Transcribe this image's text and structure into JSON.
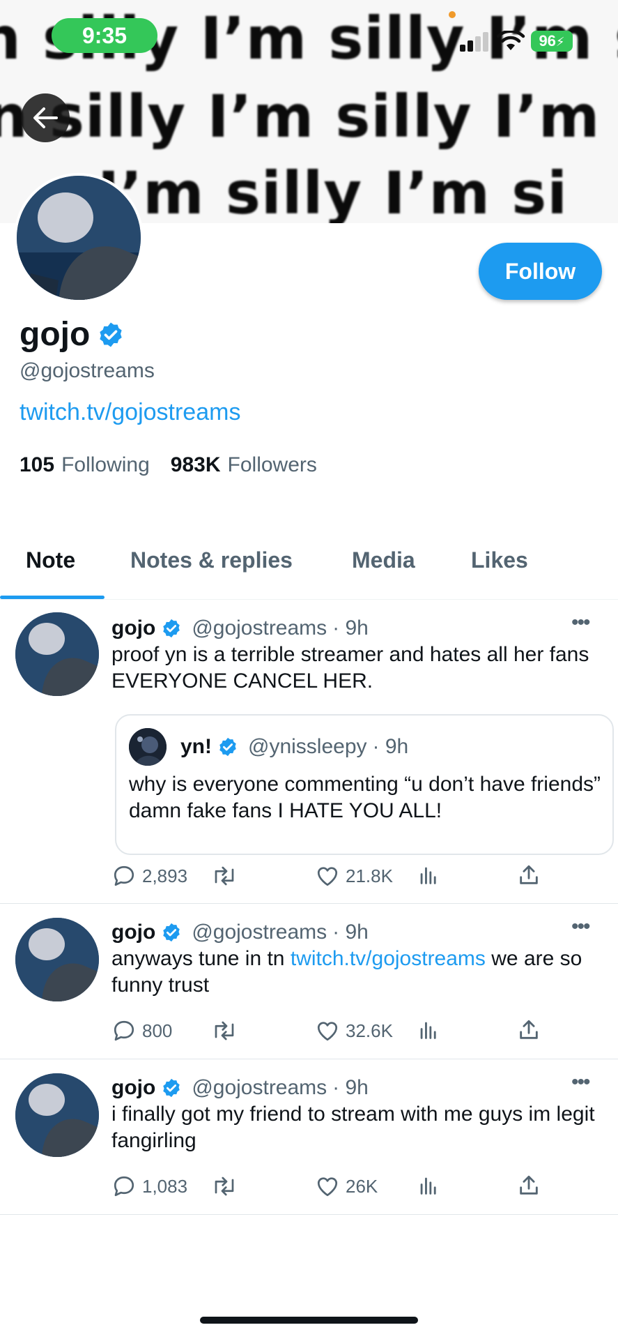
{
  "status_bar": {
    "time": "9:35",
    "battery": "96"
  },
  "banner": {
    "lines": [
      "n silly I’m silly I’m sil",
      "n silly I’m silly I’m sil",
      "I’m silly I’m si"
    ]
  },
  "profile": {
    "name": "gojo",
    "handle": "@gojostreams",
    "link": "twitch.tv/gojostreams",
    "following_count": "105",
    "following_label": "Following",
    "followers_count": "983K",
    "followers_label": "Followers",
    "follow_button": "Follow"
  },
  "tabs": [
    {
      "label": "Note"
    },
    {
      "label": "Notes & replies"
    },
    {
      "label": "Media"
    },
    {
      "label": "Likes"
    }
  ],
  "posts": [
    {
      "author": "gojo",
      "handle": "@gojostreams",
      "time": "· 9h",
      "text": "proof yn is a terrible streamer and hates all her fans EVERYONE CANCEL HER.",
      "quote": {
        "author": "yn!",
        "handle": "@ynissleepy",
        "time": "· 9h",
        "text": "why is everyone commenting “u don’t have friends” damn fake fans I HATE YOU ALL!"
      },
      "replies": "2,893",
      "likes": "21.8K"
    },
    {
      "author": "gojo",
      "handle": "@gojostreams",
      "time": "· 9h",
      "text_before": "anyways tune in tn",
      "text_link": "twitch.tv/gojostreams",
      "text_after": "we are so funny trust",
      "replies": "800",
      "likes": "32.6K"
    },
    {
      "author": "gojo",
      "handle": "@gojostreams",
      "time": "· 9h",
      "text": "i finally got my friend to stream with me guys im legit fangirling",
      "replies": "1,083",
      "likes": "26K"
    }
  ],
  "colors": {
    "accent": "#1d9bf0",
    "status_green": "#34c759",
    "secondary_text": "#536471"
  }
}
